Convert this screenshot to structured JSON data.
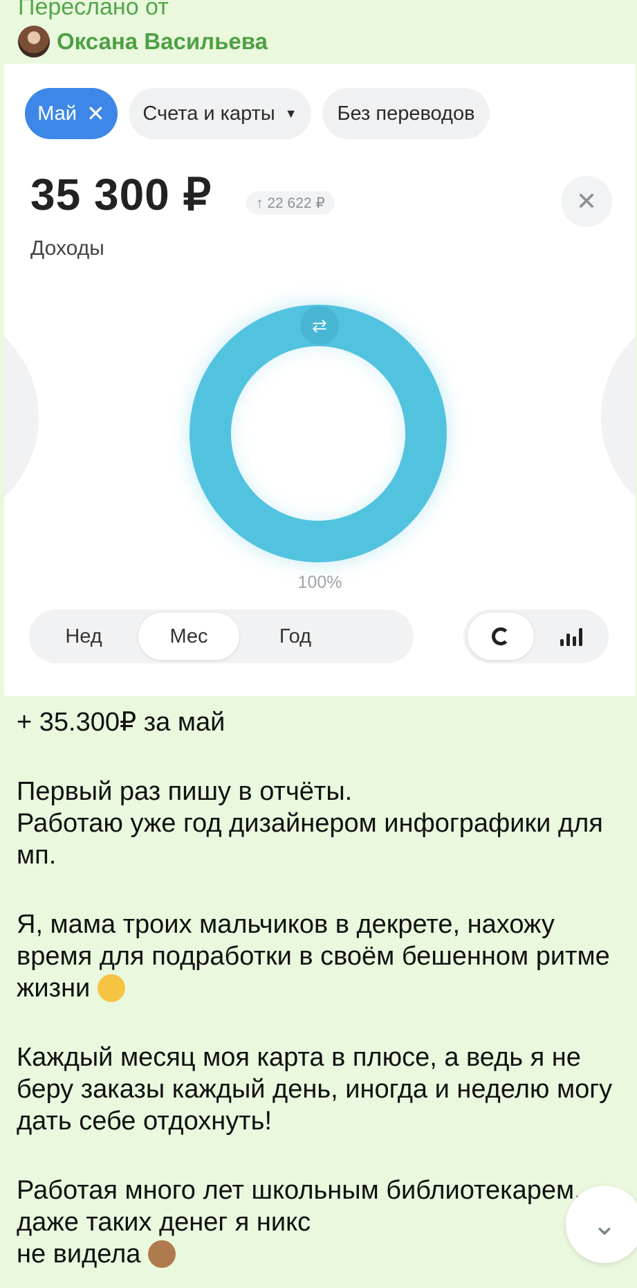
{
  "forward": {
    "label": "Переслано от",
    "sender": "Оксана Васильева"
  },
  "screenshot": {
    "chips": [
      {
        "label": "Май",
        "active": true,
        "icon": "close-icon"
      },
      {
        "label": "Счета и карты",
        "icon": "triangle-down-icon"
      },
      {
        "label": "Без переводов"
      }
    ],
    "amount": "35 300 ₽",
    "delta": "↑ 22 622 ₽",
    "income_label": "Доходы",
    "close_symbol": "✕",
    "donut_percent_label": "100%",
    "period_tabs": [
      "Нед",
      "Мес",
      "Год"
    ],
    "active_period": "Мес",
    "colors": {
      "accent": "#3d87e8",
      "donut": "#52c3df"
    }
  },
  "message": {
    "lines": [
      "+ 35.300₽ за май",
      "",
      "Первый раз пишу в отчёты.",
      "Работаю уже год дизайнером инфографики для мп.",
      "",
      "Я, мама троих мальчиков в декрете, нахожу время для подработки в своём бешенном ритме жизни",
      "",
      "Каждый месяц моя карта в плюсе, а ведь я не беру заказы каждый день, иногда и неделю могу дать себе отдохнуть!",
      "",
      "Работая много лет школьным библиотекарем, даже таких денег я никс",
      "не видела"
    ]
  }
}
